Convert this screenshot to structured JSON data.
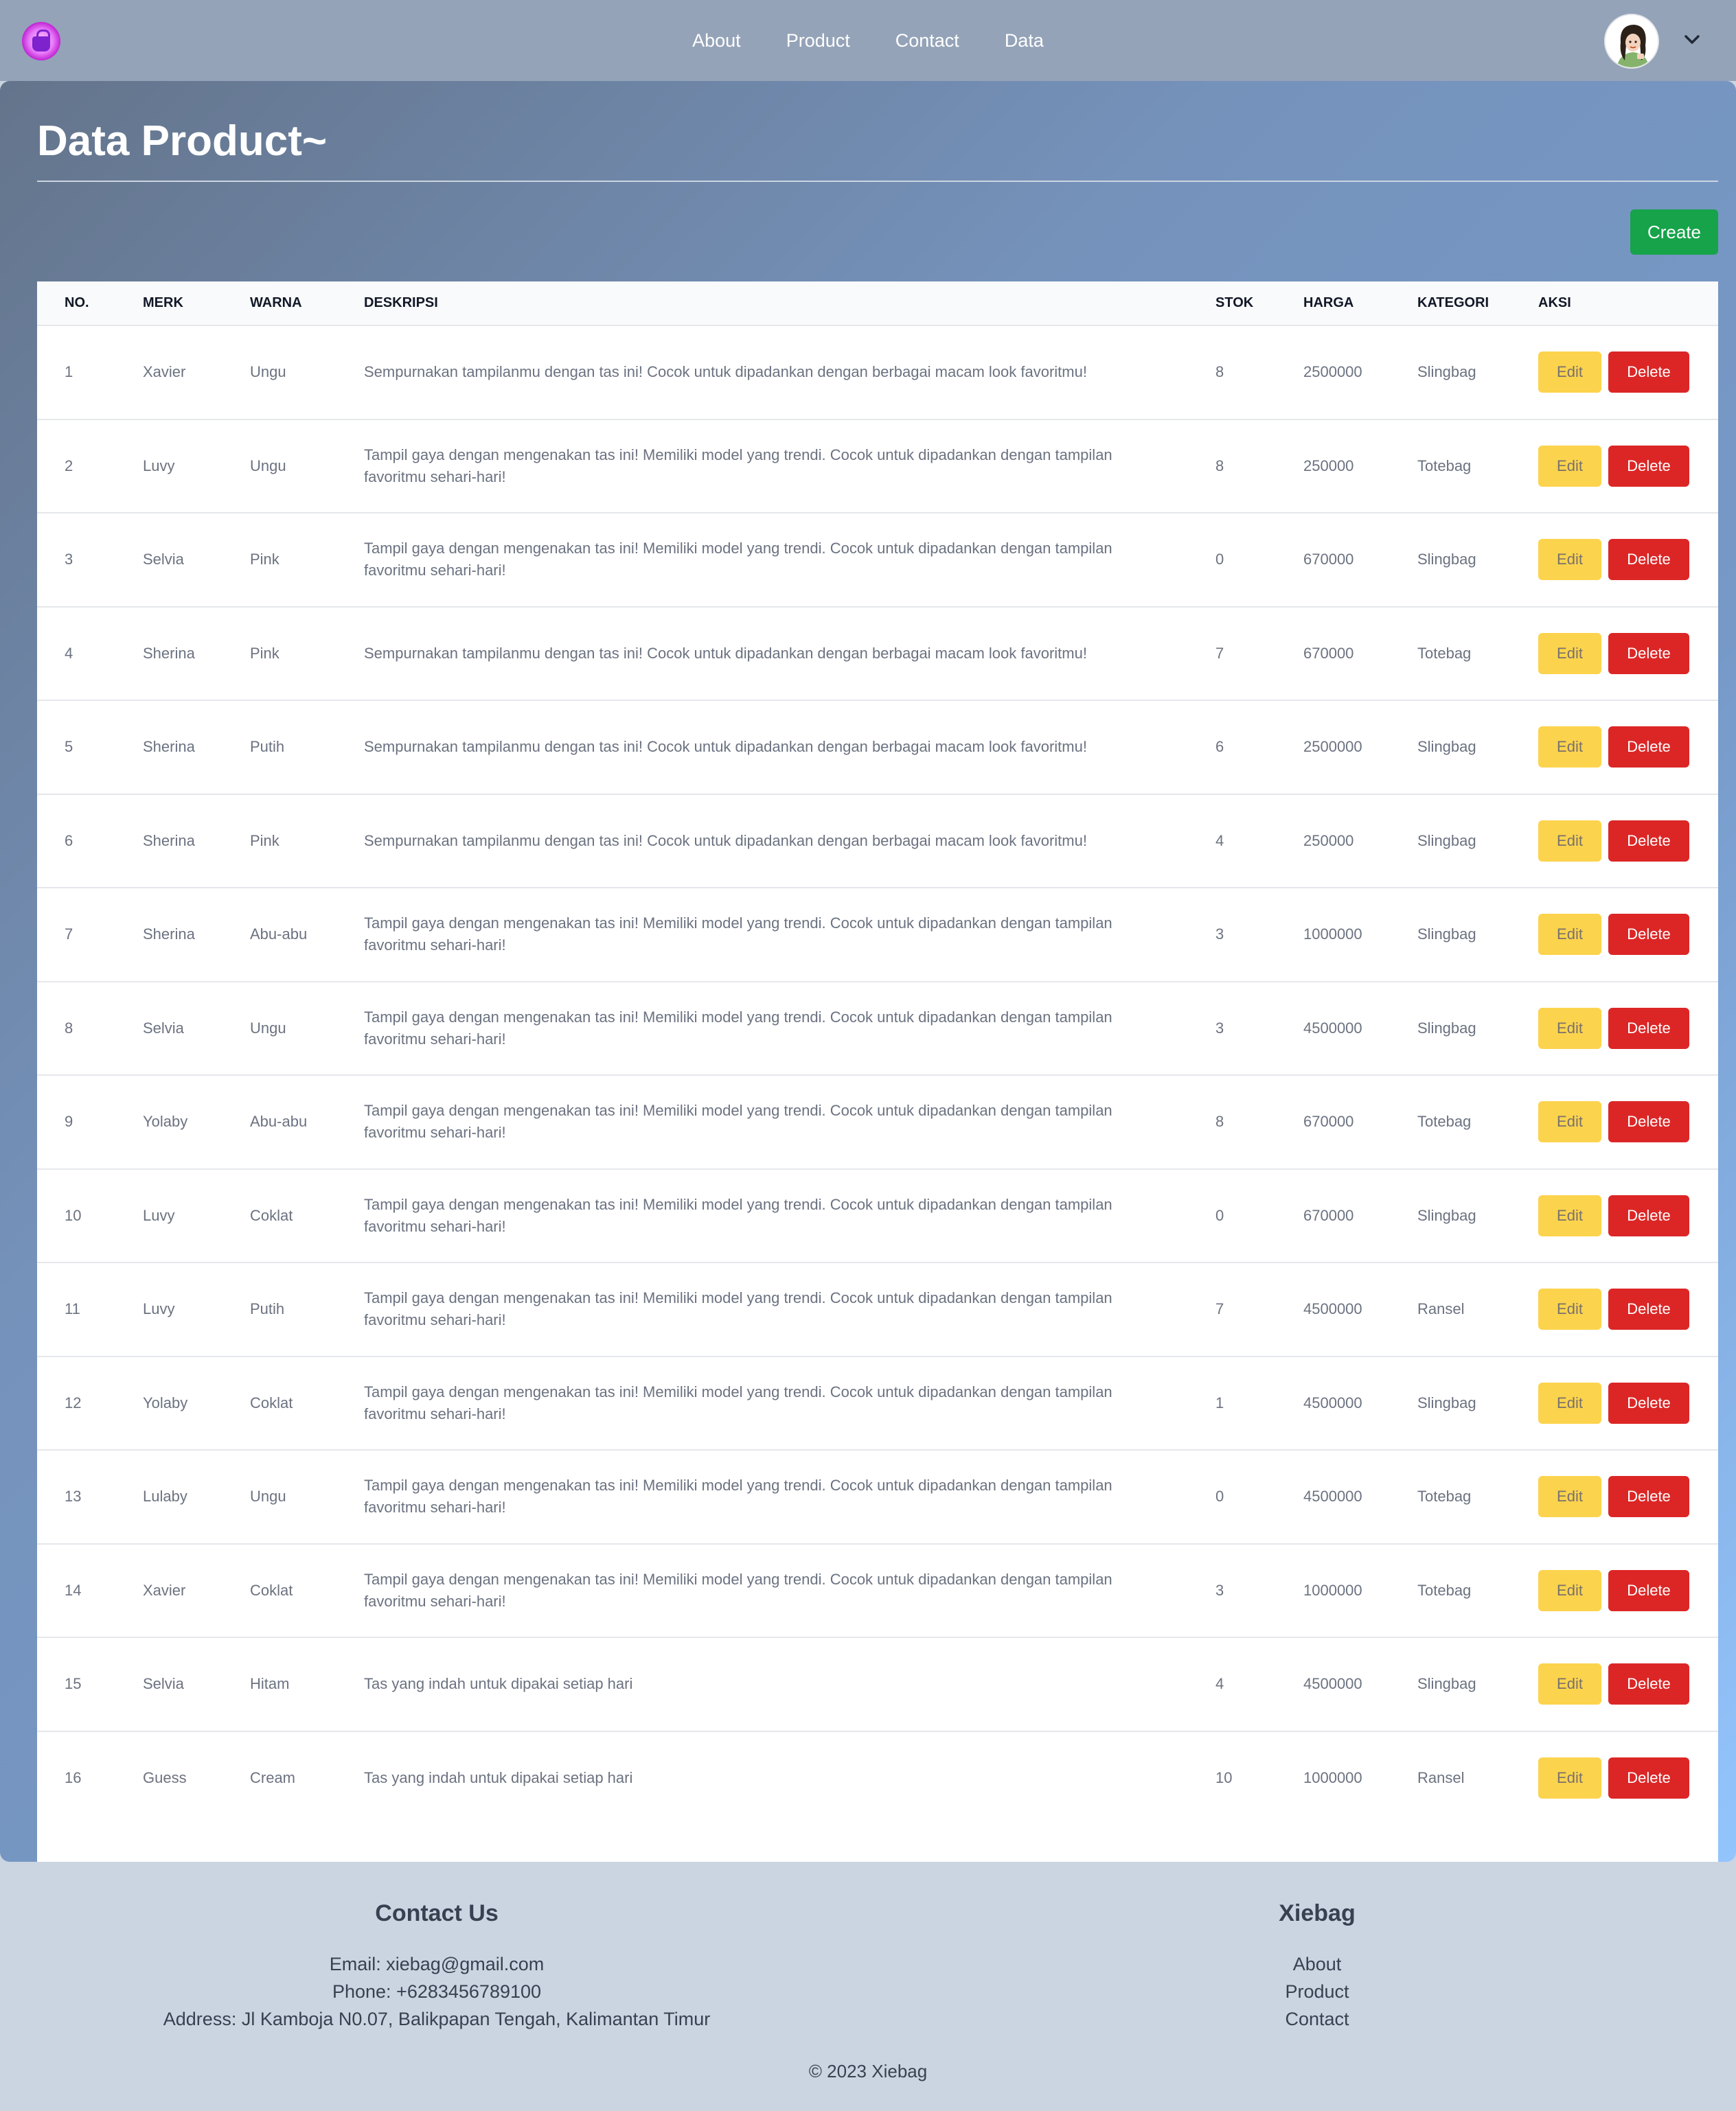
{
  "nav": {
    "links": [
      "About",
      "Product",
      "Contact",
      "Data"
    ]
  },
  "page": {
    "title": "Data Product~",
    "create_label": "Create"
  },
  "table": {
    "headers": [
      "No.",
      "Merk",
      "Warna",
      "Deskripsi",
      "Stok",
      "Harga",
      "Kategori",
      "Aksi"
    ],
    "edit_label": "Edit",
    "delete_label": "Delete",
    "rows": [
      {
        "no": "1",
        "merk": "Xavier",
        "warna": "Ungu",
        "deskripsi": "Sempurnakan tampilanmu dengan tas ini! Cocok untuk dipadankan dengan berbagai macam look favoritmu!",
        "stok": "8",
        "harga": "2500000",
        "kategori": "Slingbag"
      },
      {
        "no": "2",
        "merk": "Luvy",
        "warna": "Ungu",
        "deskripsi": "Tampil gaya dengan mengenakan tas ini! Memiliki model yang trendi. Cocok untuk dipadankan dengan tampilan favoritmu sehari-hari!",
        "stok": "8",
        "harga": "250000",
        "kategori": "Totebag"
      },
      {
        "no": "3",
        "merk": "Selvia",
        "warna": "Pink",
        "deskripsi": "Tampil gaya dengan mengenakan tas ini! Memiliki model yang trendi. Cocok untuk dipadankan dengan tampilan favoritmu sehari-hari!",
        "stok": "0",
        "harga": "670000",
        "kategori": "Slingbag"
      },
      {
        "no": "4",
        "merk": "Sherina",
        "warna": "Pink",
        "deskripsi": "Sempurnakan tampilanmu dengan tas ini! Cocok untuk dipadankan dengan berbagai macam look favoritmu!",
        "stok": "7",
        "harga": "670000",
        "kategori": "Totebag"
      },
      {
        "no": "5",
        "merk": "Sherina",
        "warna": "Putih",
        "deskripsi": "Sempurnakan tampilanmu dengan tas ini! Cocok untuk dipadankan dengan berbagai macam look favoritmu!",
        "stok": "6",
        "harga": "2500000",
        "kategori": "Slingbag"
      },
      {
        "no": "6",
        "merk": "Sherina",
        "warna": "Pink",
        "deskripsi": "Sempurnakan tampilanmu dengan tas ini! Cocok untuk dipadankan dengan berbagai macam look favoritmu!",
        "stok": "4",
        "harga": "250000",
        "kategori": "Slingbag"
      },
      {
        "no": "7",
        "merk": "Sherina",
        "warna": "Abu-abu",
        "deskripsi": "Tampil gaya dengan mengenakan tas ini! Memiliki model yang trendi. Cocok untuk dipadankan dengan tampilan favoritmu sehari-hari!",
        "stok": "3",
        "harga": "1000000",
        "kategori": "Slingbag"
      },
      {
        "no": "8",
        "merk": "Selvia",
        "warna": "Ungu",
        "deskripsi": "Tampil gaya dengan mengenakan tas ini! Memiliki model yang trendi. Cocok untuk dipadankan dengan tampilan favoritmu sehari-hari!",
        "stok": "3",
        "harga": "4500000",
        "kategori": "Slingbag"
      },
      {
        "no": "9",
        "merk": "Yolaby",
        "warna": "Abu-abu",
        "deskripsi": "Tampil gaya dengan mengenakan tas ini! Memiliki model yang trendi. Cocok untuk dipadankan dengan tampilan favoritmu sehari-hari!",
        "stok": "8",
        "harga": "670000",
        "kategori": "Totebag"
      },
      {
        "no": "10",
        "merk": "Luvy",
        "warna": "Coklat",
        "deskripsi": "Tampil gaya dengan mengenakan tas ini! Memiliki model yang trendi. Cocok untuk dipadankan dengan tampilan favoritmu sehari-hari!",
        "stok": "0",
        "harga": "670000",
        "kategori": "Slingbag"
      },
      {
        "no": "11",
        "merk": "Luvy",
        "warna": "Putih",
        "deskripsi": "Tampil gaya dengan mengenakan tas ini! Memiliki model yang trendi. Cocok untuk dipadankan dengan tampilan favoritmu sehari-hari!",
        "stok": "7",
        "harga": "4500000",
        "kategori": "Ransel"
      },
      {
        "no": "12",
        "merk": "Yolaby",
        "warna": "Coklat",
        "deskripsi": "Tampil gaya dengan mengenakan tas ini! Memiliki model yang trendi. Cocok untuk dipadankan dengan tampilan favoritmu sehari-hari!",
        "stok": "1",
        "harga": "4500000",
        "kategori": "Slingbag"
      },
      {
        "no": "13",
        "merk": "Lulaby",
        "warna": "Ungu",
        "deskripsi": "Tampil gaya dengan mengenakan tas ini! Memiliki model yang trendi. Cocok untuk dipadankan dengan tampilan favoritmu sehari-hari!",
        "stok": "0",
        "harga": "4500000",
        "kategori": "Totebag"
      },
      {
        "no": "14",
        "merk": "Xavier",
        "warna": "Coklat",
        "deskripsi": "Tampil gaya dengan mengenakan tas ini! Memiliki model yang trendi. Cocok untuk dipadankan dengan tampilan favoritmu sehari-hari!",
        "stok": "3",
        "harga": "1000000",
        "kategori": "Totebag"
      },
      {
        "no": "15",
        "merk": "Selvia",
        "warna": "Hitam",
        "deskripsi": "Tas yang indah untuk dipakai setiap hari",
        "stok": "4",
        "harga": "4500000",
        "kategori": "Slingbag"
      },
      {
        "no": "16",
        "merk": "Guess",
        "warna": "Cream",
        "deskripsi": "Tas yang indah untuk dipakai setiap hari",
        "stok": "10",
        "harga": "1000000",
        "kategori": "Ransel"
      }
    ]
  },
  "footer": {
    "contact_title": "Contact Us",
    "email": "Email: xiebag@gmail.com",
    "phone": "Phone: +6283456789100",
    "address": "Address: Jl Kamboja N0.07, Balikpapan Tengah, Kalimantan Timur",
    "brand_title": "Xiebag",
    "links": [
      "About",
      "Product",
      "Contact"
    ],
    "copyright": "© 2023 Xiebag"
  },
  "icons": {
    "logo": "handbag-logo-icon",
    "avatar": "user-avatar",
    "menu": "chevron-down-icon"
  },
  "colors": {
    "create": "#16a34a",
    "edit": "#fcd34d",
    "delete": "#dc2626",
    "navbar": "#94a3b8"
  }
}
